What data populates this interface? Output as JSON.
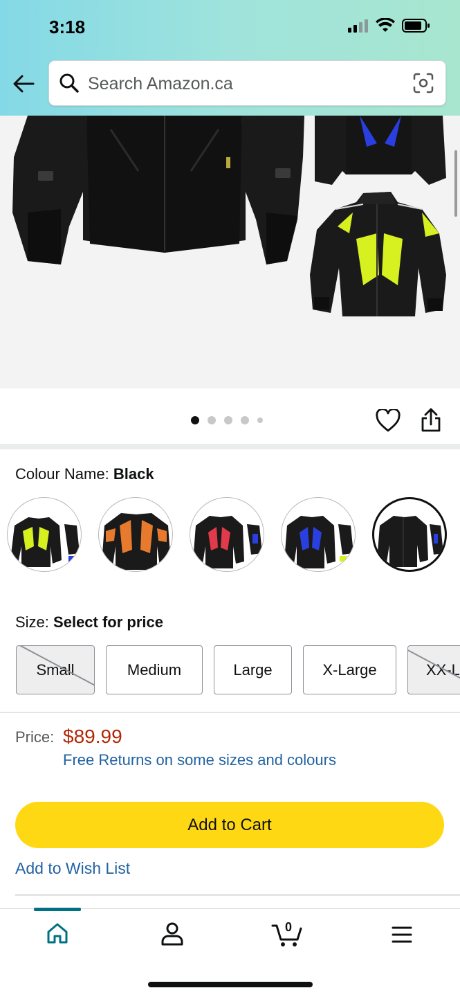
{
  "status_bar": {
    "time": "3:18",
    "icons": [
      "signal-icon",
      "wifi-icon",
      "battery-icon"
    ]
  },
  "header": {
    "search_placeholder": "Search Amazon.ca",
    "icons": [
      "back-arrow-icon",
      "search-icon",
      "camera-lens-icon"
    ]
  },
  "gallery": {
    "dot_count": 5,
    "active_dot": 1,
    "icons": [
      "heart-icon",
      "share-icon"
    ]
  },
  "colour": {
    "label": "Colour Name:",
    "value": "Black",
    "swatches": [
      {
        "name": "Green",
        "accent": "#d7f01f"
      },
      {
        "name": "Orange",
        "accent": "#e87a2e"
      },
      {
        "name": "Red",
        "accent": "#e23a4a"
      },
      {
        "name": "Blue",
        "accent": "#2a3fe0"
      },
      {
        "name": "Black",
        "accent": "#2b2b2b",
        "selected": true
      }
    ]
  },
  "size": {
    "label": "Size:",
    "value": "Select for price",
    "options": [
      {
        "label": "Small",
        "available": false
      },
      {
        "label": "Medium",
        "available": true
      },
      {
        "label": "Large",
        "available": true
      },
      {
        "label": "X-Large",
        "available": true
      },
      {
        "label": "XX-L",
        "available": false
      }
    ]
  },
  "price": {
    "label": "Price:",
    "value": "$89.99",
    "returns": "Free Returns on some sizes and colours"
  },
  "actions": {
    "add_to_cart": "Add to Cart",
    "add_to_wish_list": "Add to Wish List"
  },
  "tab_bar": {
    "cart_count": "0",
    "tabs": [
      "home-icon",
      "account-icon",
      "cart-icon",
      "menu-icon"
    ]
  },
  "colors": {
    "accent_yellow": "#ffd814",
    "price_red": "#b12704",
    "link_blue": "#2162a1",
    "teal": "#007185"
  }
}
